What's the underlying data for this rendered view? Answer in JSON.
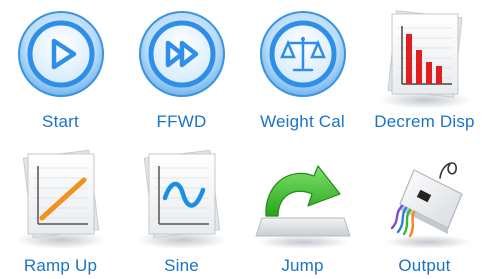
{
  "tiles": [
    {
      "label": "Start",
      "icon": "play-icon"
    },
    {
      "label": "FFWD",
      "icon": "fast-forward-icon"
    },
    {
      "label": "Weight Cal",
      "icon": "balance-scale-icon"
    },
    {
      "label": "Decrem Disp",
      "icon": "bar-chart-document-icon"
    },
    {
      "label": "Ramp Up",
      "icon": "ramp-chart-document-icon"
    },
    {
      "label": "Sine",
      "icon": "sine-wave-document-icon"
    },
    {
      "label": "Jump",
      "icon": "jump-arrow-icon"
    },
    {
      "label": "Output",
      "icon": "output-connector-icon"
    }
  ],
  "colors": {
    "label_text": "#1a73c6",
    "circle_blue": "#2f8fe8",
    "bar_red": "#e02020",
    "ramp_orange": "#f0921e",
    "jump_green": "#3cbf2c"
  }
}
